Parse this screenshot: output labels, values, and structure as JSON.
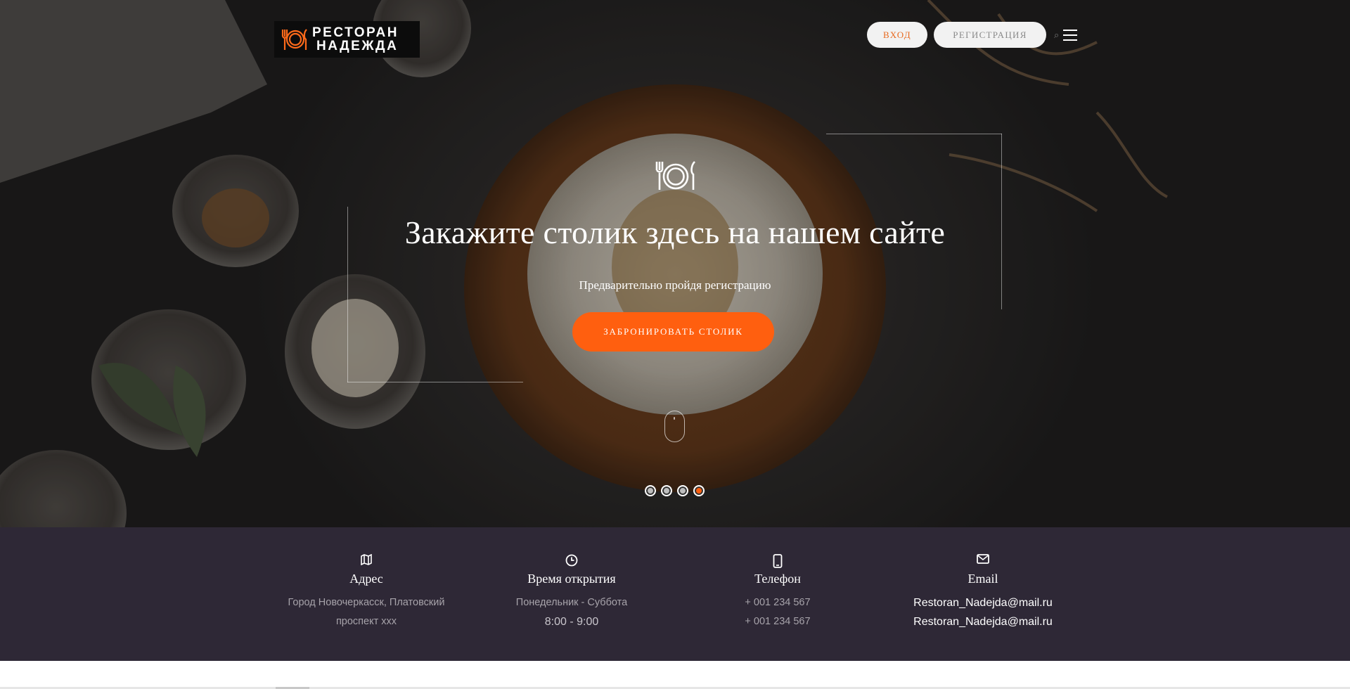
{
  "logo": {
    "line1": "РЕСТОРАН",
    "line2": "НАДЕЖДА",
    "icon": "cutlery-plate-icon"
  },
  "nav": {
    "login_label": "ВХОД",
    "register_label": "РЕГИСТРАЦИЯ",
    "menu_icon": "hamburger-menu-icon"
  },
  "hero": {
    "icon": "cutlery-plate-icon",
    "title": "Закажите столик здесь на нашем сайте",
    "subtitle": "Предварительно пройдя регистрацию",
    "cta_label": "ЗАБРОНИРОВАТЬ СТОЛИК",
    "scroll_icon": "mouse-scroll-icon",
    "slides_count": 4,
    "active_slide": 4
  },
  "info": {
    "columns": [
      {
        "icon": "map-icon",
        "title": "Адрес",
        "lines": [
          "Город Новочеркасск, Платовский",
          "проспект ххх"
        ]
      },
      {
        "icon": "clock-icon",
        "title": "Время открытия",
        "lines": [
          "Понедельник - Суббота",
          "8:00 - 9:00"
        ]
      },
      {
        "icon": "phone-icon",
        "title": "Телефон",
        "lines": [
          "+ 001 234 567",
          "+ 001 234 567"
        ]
      },
      {
        "icon": "mail-icon",
        "title": "Email",
        "lines": [
          "Restoran_Nadejda@mail.ru",
          "Restoran_Nadejda@mail.ru"
        ]
      }
    ]
  },
  "colors": {
    "accent": "#ff5f0f",
    "info_bg": "#2e2836"
  }
}
